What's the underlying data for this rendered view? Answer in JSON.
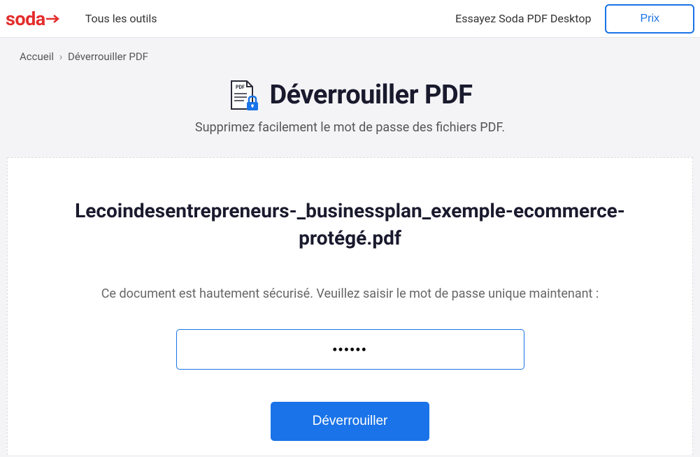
{
  "header": {
    "logo_text": "soda",
    "tools_label": "Tous les outils",
    "desktop_label": "Essayez Soda PDF Desktop",
    "price_label": "Prix"
  },
  "breadcrumb": {
    "home": "Accueil",
    "current": "Déverrouiller PDF"
  },
  "hero": {
    "title": "Déverrouiller PDF",
    "subtitle": "Supprimez facilement le mot de passe des fichiers PDF."
  },
  "card": {
    "file_name": "Lecoindesentrepreneurs-_businessplan_exemple-ecommerce-protégé.pdf",
    "prompt": "Ce document est hautement sécurisé. Veuillez saisir le mot de passe unique maintenant :",
    "password_value": "••••••",
    "unlock_label": "Déverrouiller"
  }
}
